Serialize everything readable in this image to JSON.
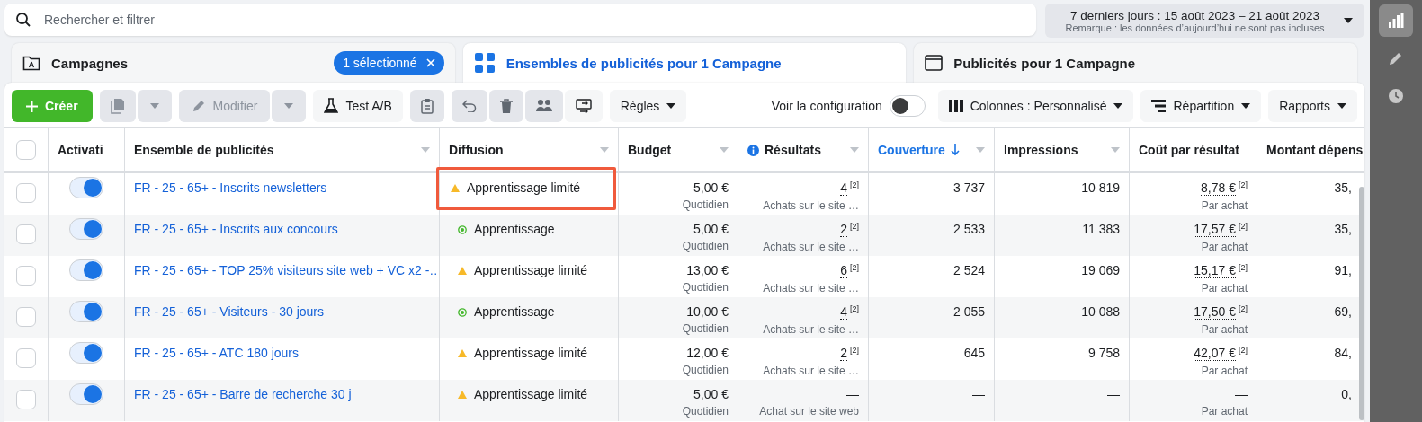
{
  "search": {
    "placeholder": "Rechercher et filtrer"
  },
  "date_range": {
    "label": "7 derniers jours : 15 août 2023 – 21 août 2023",
    "note": "Remarque : les données d’aujourd’hui ne sont pas incluses"
  },
  "tabs": [
    {
      "kind": "campaigns",
      "label": "Campagnes",
      "selected": false,
      "badge": "1 sélectionné"
    },
    {
      "kind": "adsets",
      "label": "Ensembles de publicités pour 1 Campagne",
      "selected": true
    },
    {
      "kind": "ads",
      "label": "Publicités pour 1 Campagne",
      "selected": false
    }
  ],
  "toolbar": {
    "create": "Créer",
    "modify": {
      "label": "Modifier",
      "disabled": true
    },
    "ab_test": "Test A/B",
    "rules": "Règles",
    "config": {
      "label": "Voir la configuration",
      "on": false
    },
    "columns": "Colonnes : Personnalisé",
    "breakdown": "Répartition",
    "reports": "Rapports"
  },
  "select_all": {
    "checked": false
  },
  "columns": [
    {
      "label": "Activati",
      "sorted": false,
      "info": false
    },
    {
      "label": "Ensemble de publicités",
      "sorted": false,
      "info": false
    },
    {
      "label": "Diffusion",
      "sorted": false,
      "info": false
    },
    {
      "label": "Budget",
      "sorted": false,
      "info": false
    },
    {
      "label": "Résultats",
      "sorted": false,
      "info": true
    },
    {
      "label": "Couverture",
      "sorted": true,
      "info": false
    },
    {
      "label": "Impressions",
      "sorted": false,
      "info": false
    },
    {
      "label": "Coût par résultat",
      "sorted": false,
      "info": false
    },
    {
      "label": "Montant dépens",
      "sorted": false,
      "info": false
    }
  ],
  "rows": [
    {
      "checked": false,
      "on": true,
      "name": "FR - 25 - 65+ - Inscrits newsletters",
      "delivery": {
        "kind": "limited",
        "label": "Apprentissage limité"
      },
      "highlighted": true,
      "budget": {
        "value": "5,00 €",
        "period": "Quotidien"
      },
      "results": {
        "value": "4",
        "note": "[2]",
        "sub": "Achats sur le site …"
      },
      "reach": "3 737",
      "impressions": "10 819",
      "cost": {
        "value": "8,78 €",
        "note": "[2]",
        "sub": "Par achat"
      },
      "spent": "35,"
    },
    {
      "checked": false,
      "on": true,
      "name": "FR - 25 - 65+ - Inscrits aux concours",
      "delivery": {
        "kind": "learning",
        "label": "Apprentissage"
      },
      "highlighted": false,
      "budget": {
        "value": "5,00 €",
        "period": "Quotidien"
      },
      "results": {
        "value": "2",
        "note": "[2]",
        "sub": "Achats sur le site …"
      },
      "reach": "2 533",
      "impressions": "11 383",
      "cost": {
        "value": "17,57 €",
        "note": "[2]",
        "sub": "Par achat"
      },
      "spent": "35,"
    },
    {
      "checked": false,
      "on": true,
      "name": "FR - 25 - 65+ - TOP 25% visiteurs site web + VC x2 -…",
      "delivery": {
        "kind": "limited",
        "label": "Apprentissage limité"
      },
      "highlighted": false,
      "budget": {
        "value": "13,00 €",
        "period": "Quotidien"
      },
      "results": {
        "value": "6",
        "note": "[2]",
        "sub": "Achats sur le site …"
      },
      "reach": "2 524",
      "impressions": "19 069",
      "cost": {
        "value": "15,17 €",
        "note": "[2]",
        "sub": "Par achat"
      },
      "spent": "91,"
    },
    {
      "checked": false,
      "on": true,
      "name": "FR - 25 - 65+ - Visiteurs - 30 jours",
      "delivery": {
        "kind": "learning",
        "label": "Apprentissage"
      },
      "highlighted": false,
      "budget": {
        "value": "10,00 €",
        "period": "Quotidien"
      },
      "results": {
        "value": "4",
        "note": "[2]",
        "sub": "Achats sur le site …"
      },
      "reach": "2 055",
      "impressions": "10 088",
      "cost": {
        "value": "17,50 €",
        "note": "[2]",
        "sub": "Par achat"
      },
      "spent": "69,"
    },
    {
      "checked": false,
      "on": true,
      "name": "FR - 25 - 65+ - ATC 180 jours",
      "delivery": {
        "kind": "limited",
        "label": "Apprentissage limité"
      },
      "highlighted": false,
      "budget": {
        "value": "12,00 €",
        "period": "Quotidien"
      },
      "results": {
        "value": "2",
        "note": "[2]",
        "sub": "Achats sur le site …"
      },
      "reach": "645",
      "impressions": "9 758",
      "cost": {
        "value": "42,07 €",
        "note": "[2]",
        "sub": "Par achat"
      },
      "spent": "84,"
    },
    {
      "checked": false,
      "on": true,
      "name": "FR - 25 - 65+ - Barre de recherche 30 j",
      "delivery": {
        "kind": "limited",
        "label": "Apprentissage limité"
      },
      "highlighted": false,
      "budget": {
        "value": "5,00 €",
        "period": "Quotidien"
      },
      "results": {
        "value": "—",
        "sub": "Achat sur le site web"
      },
      "reach": "—",
      "impressions": "—",
      "cost": {
        "value": "—",
        "sub": "Par achat"
      },
      "spent": "0,"
    }
  ],
  "sidebar": [
    {
      "kind": "chart",
      "selected": true
    },
    {
      "kind": "edit",
      "selected": false
    },
    {
      "kind": "history",
      "selected": false
    }
  ]
}
